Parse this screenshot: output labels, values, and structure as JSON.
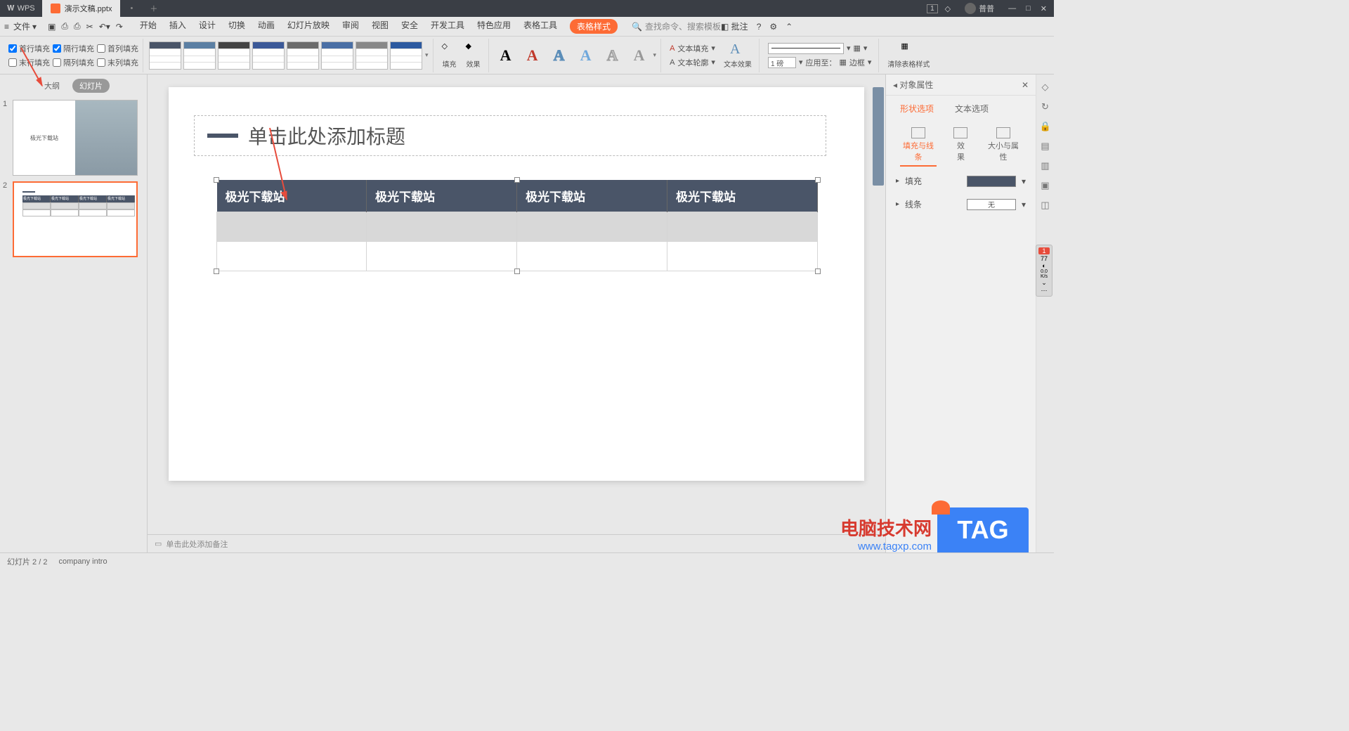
{
  "titlebar": {
    "app": "WPS",
    "tab": "演示文稿.pptx",
    "modified": "•",
    "user": "普普"
  },
  "menubar": {
    "file": "文件",
    "menus": [
      "开始",
      "插入",
      "设计",
      "切换",
      "动画",
      "幻灯片放映",
      "审阅",
      "视图",
      "安全",
      "开发工具",
      "特色应用",
      "表格工具",
      "表格样式"
    ],
    "active_index": 12,
    "search_placeholder": "查找命令、搜索模板",
    "annotate": "批注"
  },
  "ribbon": {
    "checks": {
      "r1": [
        "首行填充",
        "隔行填充",
        "首列填充"
      ],
      "r2": [
        "末行填充",
        "隔列填充",
        "末列填充"
      ]
    },
    "check_states": {
      "首行填充": true,
      "隔行填充": true,
      "首列填充": false,
      "末行填充": false,
      "隔列填充": false,
      "末列填充": false
    },
    "fill_btn": "填充",
    "effect_btn": "效果",
    "text_fill": "文本填充",
    "text_outline": "文本轮廓",
    "text_effect": "文本效果",
    "weight": "1 磅",
    "apply_to": "应用至：",
    "border": "边框",
    "clear_style": "清除表格样式"
  },
  "slide_tabs": {
    "outline": "大纲",
    "slides": "幻灯片"
  },
  "thumbs": {
    "t1_text": "极光下载站",
    "t2_headers": [
      "极光下载站",
      "极光下载站",
      "极光下载站",
      "极光下载站"
    ]
  },
  "slide": {
    "title_placeholder": "单击此处添加标题",
    "table_headers": [
      "极光下载站",
      "极光下载站",
      "极光下载站",
      "极光下载站"
    ]
  },
  "notes": "单击此处添加备注",
  "right": {
    "title": "对象属性",
    "tab_shape": "形状选项",
    "tab_text": "文本选项",
    "sub_fill": "填充与线条",
    "sub_effect": "效果",
    "sub_size": "大小与属性",
    "fill": "填充",
    "line": "线条",
    "line_value": "无"
  },
  "status": {
    "slide_info": "幻灯片 2 / 2",
    "lang": "company intro"
  },
  "watermark": {
    "line1": "电脑技术网",
    "line2": "www.tagxp.com",
    "tag": "TAG"
  }
}
